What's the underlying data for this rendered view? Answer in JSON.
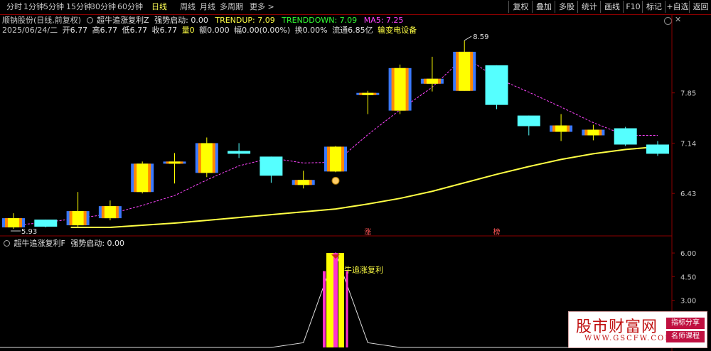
{
  "toolbar": {
    "left_items": [
      "分时",
      "1分钟",
      "5分钟",
      "15分钟",
      "30分钟",
      "60分钟",
      "日线",
      "周线",
      "月线",
      "多周期",
      "更多 >"
    ],
    "active": "日线",
    "right_items": [
      "复权",
      "叠加",
      "多股",
      "统计",
      "画线",
      "F10",
      "标记",
      "+自选",
      "返回"
    ]
  },
  "info_line1": {
    "stock": "顺钠股份(日线,前复权)",
    "indicator": "超牛追涨复利Z",
    "strong_label": "强势启动: 0.00",
    "trendup": "TRENDUP: 7.09",
    "trenddown": "TRENDDOWN: 7.09",
    "ma5": "MA5: 7.25"
  },
  "info_line2": {
    "date": "2025/06/24/二",
    "open": "开6.77",
    "high": "高6.77",
    "low": "低6.77",
    "close": "收6.77",
    "volume": "量0",
    "amount": "额0.000",
    "amplitude": "幅0.00(0.00%)",
    "turnover": "换0.00%",
    "float": "流通6.85亿",
    "industry": "输变电设备"
  },
  "colors": {
    "up_outer": "#ffff00",
    "up_inner": "#3a78ff",
    "up_accent": "#ff8800",
    "down": "#55ffff",
    "ma5": "#ff44ff",
    "trend": "#ffff44",
    "bar_yellow": "#ffff00",
    "bar_magenta": "#ff33cc"
  },
  "main_chart": {
    "y_ticks": [
      {
        "value": 7.85,
        "label": "7.85"
      },
      {
        "value": 7.14,
        "label": "7.14"
      },
      {
        "value": 6.43,
        "label": "6.43"
      }
    ],
    "high_annotation": "8.59",
    "low_annotation": "5.93",
    "markers": [
      {
        "index": 11,
        "label": "涨"
      },
      {
        "index": 15,
        "label": "榜"
      }
    ]
  },
  "chart_data": [
    {
      "type": "candlestick",
      "ylim": [
        5.85,
        8.66
      ],
      "ohlc": [
        {
          "o": 5.95,
          "h": 6.15,
          "l": 5.93,
          "c": 6.08
        },
        {
          "o": 6.06,
          "h": 6.06,
          "l": 5.95,
          "c": 5.96
        },
        {
          "o": 5.98,
          "h": 6.45,
          "l": 5.95,
          "c": 6.18
        },
        {
          "o": 6.08,
          "h": 6.33,
          "l": 6.05,
          "c": 6.25
        },
        {
          "o": 6.45,
          "h": 6.88,
          "l": 6.43,
          "c": 6.85
        },
        {
          "o": 6.85,
          "h": 7.0,
          "l": 6.57,
          "c": 6.88
        },
        {
          "o": 6.72,
          "h": 7.22,
          "l": 6.66,
          "c": 7.14
        },
        {
          "o": 7.03,
          "h": 7.14,
          "l": 6.93,
          "c": 6.99
        },
        {
          "o": 6.95,
          "h": 6.95,
          "l": 6.58,
          "c": 6.68
        },
        {
          "o": 6.55,
          "h": 6.75,
          "l": 6.5,
          "c": 6.62
        },
        {
          "o": 6.74,
          "h": 7.1,
          "l": 6.73,
          "c": 7.09
        },
        {
          "o": 7.85,
          "h": 7.88,
          "l": 7.55,
          "c": 7.85
        },
        {
          "o": 7.6,
          "h": 8.25,
          "l": 7.55,
          "c": 8.2
        },
        {
          "o": 7.98,
          "h": 8.36,
          "l": 7.87,
          "c": 8.05
        },
        {
          "o": 7.88,
          "h": 8.59,
          "l": 7.88,
          "c": 8.43
        },
        {
          "o": 8.24,
          "h": 8.24,
          "l": 7.62,
          "c": 7.68
        },
        {
          "o": 7.53,
          "h": 7.53,
          "l": 7.25,
          "c": 7.38
        },
        {
          "o": 7.3,
          "h": 7.55,
          "l": 7.17,
          "c": 7.39
        },
        {
          "o": 7.25,
          "h": 7.4,
          "l": 7.18,
          "c": 7.33
        },
        {
          "o": 7.35,
          "h": 7.37,
          "l": 7.1,
          "c": 7.12
        },
        {
          "o": 7.12,
          "h": 7.17,
          "l": 6.96,
          "c": 6.99
        }
      ],
      "ma5": [
        null,
        null,
        null,
        null,
        6.26,
        6.4,
        6.62,
        6.82,
        6.93,
        6.86,
        6.87,
        7.26,
        7.61,
        7.93,
        8.36,
        8.06,
        7.86,
        7.65,
        7.43,
        7.25,
        7.25
      ],
      "trendup": [
        null,
        null,
        null,
        5.95,
        5.98,
        6.01,
        6.05,
        6.09,
        6.13,
        6.17,
        6.21,
        6.28,
        6.36,
        6.46,
        6.58,
        6.7,
        6.81,
        6.91,
        6.99,
        7.05,
        7.09
      ]
    },
    {
      "type": "bar",
      "title": "超牛追涨复利F",
      "strong_label": "强势启动: 0.00",
      "ylim": [
        0,
        6.5
      ],
      "y_ticks": [
        {
          "value": 6.0,
          "label": "6.00"
        },
        {
          "value": 4.5,
          "label": "4.50"
        },
        {
          "value": 3.0,
          "label": "3.00"
        }
      ],
      "signal_index": 10,
      "signal_label": "牛追涨复利",
      "bars": [
        {
          "color": "yellow",
          "offset": -1,
          "width": 10,
          "value": 6.0
        },
        {
          "color": "magenta",
          "offset": 0,
          "width": 6,
          "value": 6.0
        },
        {
          "color": "yellow",
          "offset": 1,
          "width": 8,
          "value": 6.0
        },
        {
          "color": "magenta",
          "offset": -2,
          "width": 4,
          "value": 4.85
        },
        {
          "color": "magenta",
          "offset": 2,
          "width": 3,
          "value": 4.85
        }
      ],
      "baseline_values": [
        0,
        0,
        0,
        0,
        0,
        0,
        0,
        0,
        0,
        0.3,
        6.0,
        0.3,
        0,
        0,
        0,
        0,
        0,
        0,
        0,
        0,
        0
      ]
    }
  ],
  "watermark": {
    "main": "股市财富网",
    "url": "WWW.GSCFW.COM",
    "tag1": "指标分享",
    "tag2": "名师课程"
  }
}
